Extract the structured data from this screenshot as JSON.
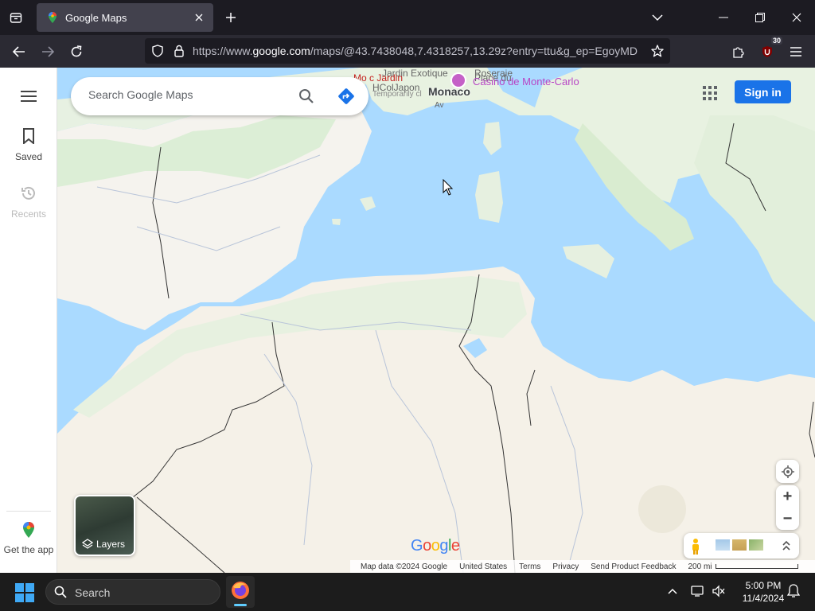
{
  "browser": {
    "tab": {
      "title": "Google Maps"
    },
    "url": {
      "prefix": "https://www.",
      "domain": "google.com",
      "suffix": "/maps/@43.7438048,7.4318257,13.29z?entry=ttu&g_ep=EgoyMDI"
    },
    "extension_badge": "30"
  },
  "sidebar": {
    "saved_label": "Saved",
    "recents_label": "Recents",
    "get_app_label": "Get the app"
  },
  "search": {
    "placeholder": "Search Google Maps"
  },
  "header": {
    "signin_label": "Sign in"
  },
  "map": {
    "labels": {
      "jardin": "Jardin Exotique",
      "moule_jardin": "Mo c Jardin",
      "roseraie": "Roseraie",
      "place": "Place du",
      "hcolapon": "HColJapon",
      "temp": "Temporarily cl",
      "monaco": "Monaco",
      "casino": "Casino de Monte-Carlo",
      "av": "Av"
    },
    "layers_label": "Layers",
    "google_logo": "Google",
    "footer": {
      "map_data": "Map data ©2024 Google",
      "country": "United States",
      "terms": "Terms",
      "privacy": "Privacy",
      "feedback": "Send Product Feedback",
      "scale": "200 mi"
    }
  },
  "taskbar": {
    "search_label": "Search",
    "time": "5:00 PM",
    "date": "11/4/2024"
  },
  "colors": {
    "water": "#aadaff",
    "land": "#f5f3ee",
    "green": "#cfe8c9",
    "accent": "#1a73e8"
  }
}
